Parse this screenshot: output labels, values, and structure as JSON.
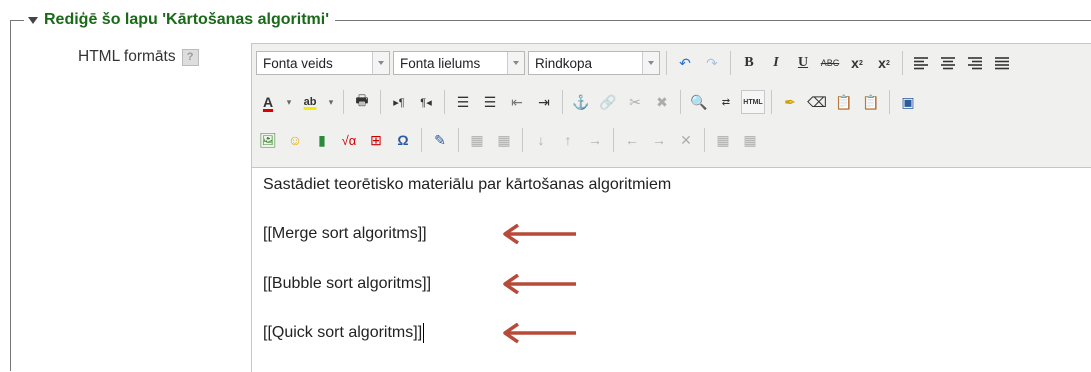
{
  "legend": {
    "title": "Rediģē šo lapu 'Kārtošanas algoritmi'"
  },
  "field": {
    "label": "HTML formāts",
    "help_icon": "?"
  },
  "toolbar": {
    "font_family": "Fonta veids",
    "font_size": "Fonta lielums",
    "paragraph": "Rindkopa"
  },
  "content": {
    "line1": "Sastādiet teorētisko materiālu par kārtošanas algoritmiem",
    "line2": "[[Merge sort algoritms]]",
    "line3": "[[Bubble sort algoritms]]",
    "line4": "[[Quick sort algoritms]]"
  },
  "colors": {
    "legend": "#1a6a1a",
    "arrow": "#b84a3a"
  }
}
